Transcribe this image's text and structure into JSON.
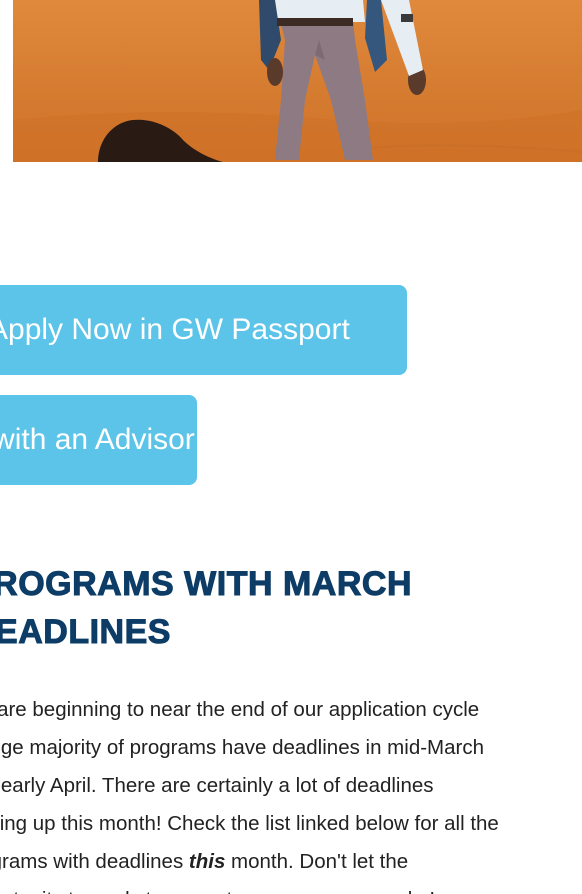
{
  "hero": {
    "image_alt": "Student standing in desert sand dunes"
  },
  "buttons": {
    "apply_label": "Apply Now in GW Passport",
    "advisor_label": "Meet with an Advisor"
  },
  "section": {
    "heading_line1": "PROGRAMS WITH MARCH",
    "heading_line2": "DEADLINES",
    "body": {
      "line1": "We are beginning to near the end of our application cycle",
      "line2": "a huge majority of programs have deadlines in mid-March",
      "line3": "and early April. There are certainly a lot of deadlines",
      "line4": "coming up this month! Check the list linked below for all the",
      "line5_pre": "programs with deadlines ",
      "line5_em": "this",
      "line5_post": " month. Don't let the",
      "line6": "opportunity to apply to a great program pass you by!"
    }
  },
  "colors": {
    "button_bg": "#5bc4e8",
    "heading": "#0d3d66",
    "sand": "#d77e33"
  }
}
